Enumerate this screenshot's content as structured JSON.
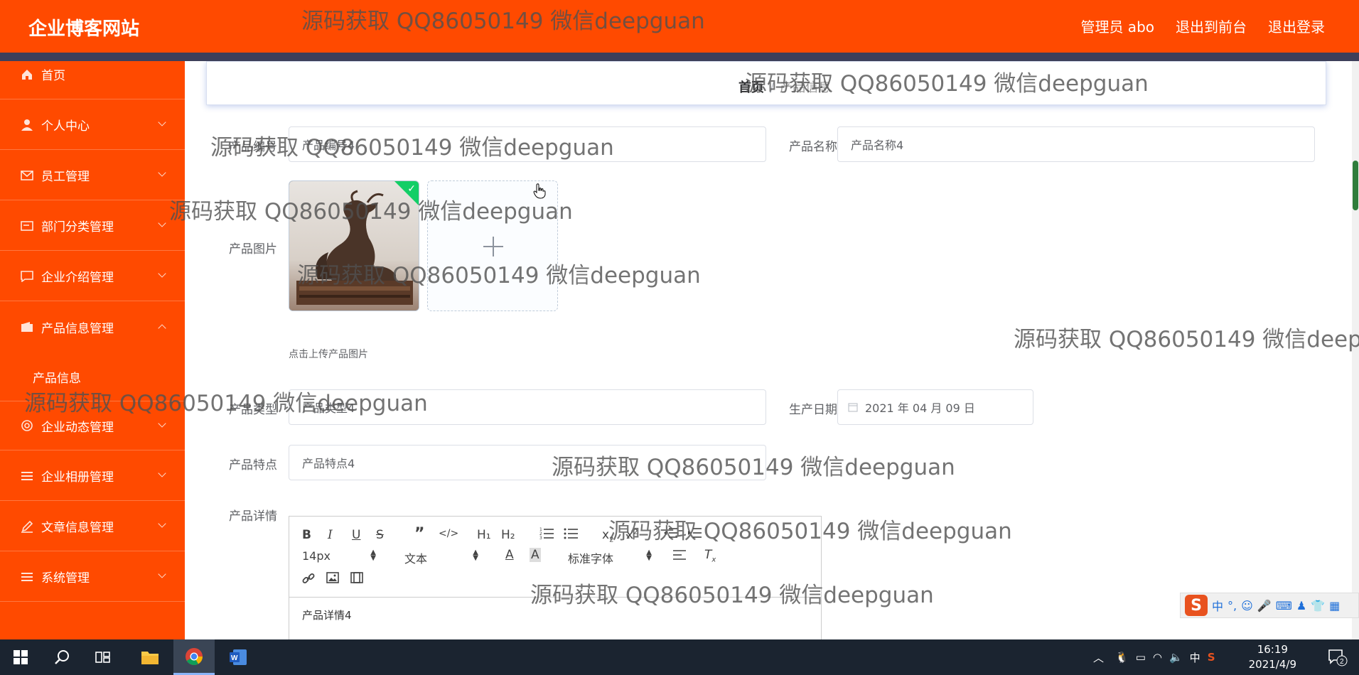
{
  "header": {
    "logo": "企业博客网站",
    "admin": "管理员 abo",
    "to_front": "退出到前台",
    "logout": "退出登录"
  },
  "sidebar": {
    "items": [
      {
        "label": "首页",
        "icon": "home-icon"
      },
      {
        "label": "个人中心",
        "icon": "user-icon"
      },
      {
        "label": "员工管理",
        "icon": "mail-icon"
      },
      {
        "label": "部门分类管理",
        "icon": "card-icon"
      },
      {
        "label": "企业介绍管理",
        "icon": "chat-icon"
      },
      {
        "label": "产品信息管理",
        "icon": "wallet-icon"
      },
      {
        "label": "企业动态管理",
        "icon": "circle-icon"
      },
      {
        "label": "企业相册管理",
        "icon": "list-icon"
      },
      {
        "label": "文章信息管理",
        "icon": "edit-icon"
      },
      {
        "label": "系统管理",
        "icon": "list-icon"
      }
    ],
    "sub_item": "产品信息"
  },
  "breadcrumb": {
    "home": "首页",
    "current": "产品信息"
  },
  "form": {
    "product_no_label": "产品编号",
    "product_no_value": "产品编号4",
    "product_name_label": "产品名称",
    "product_name_value": "产品名称4",
    "image_label": "产品图片",
    "upload_tip": "点击上传产品图片",
    "type_label": "产品类型",
    "type_value": "产品类型4",
    "date_label": "生产日期",
    "date_value": "2021 年 04 月 09 日",
    "feature_label": "产品特点",
    "feature_value": "产品特点4",
    "detail_label": "产品详情"
  },
  "editor": {
    "font_size": "14px",
    "text_style": "文本",
    "font_family": "标准字体",
    "h1": "H₁",
    "h2": "H₂",
    "content": "产品详情4"
  },
  "watermark": "源码获取 QQ86050149 微信deepguan",
  "taskbar": {
    "time": "16:19",
    "date": "2021/4/9",
    "ime_lang": "中",
    "notifications": "2"
  },
  "colors": {
    "primary": "#ff4a00",
    "strip": "#3d3f5a",
    "taskbar": "#1b2430"
  }
}
